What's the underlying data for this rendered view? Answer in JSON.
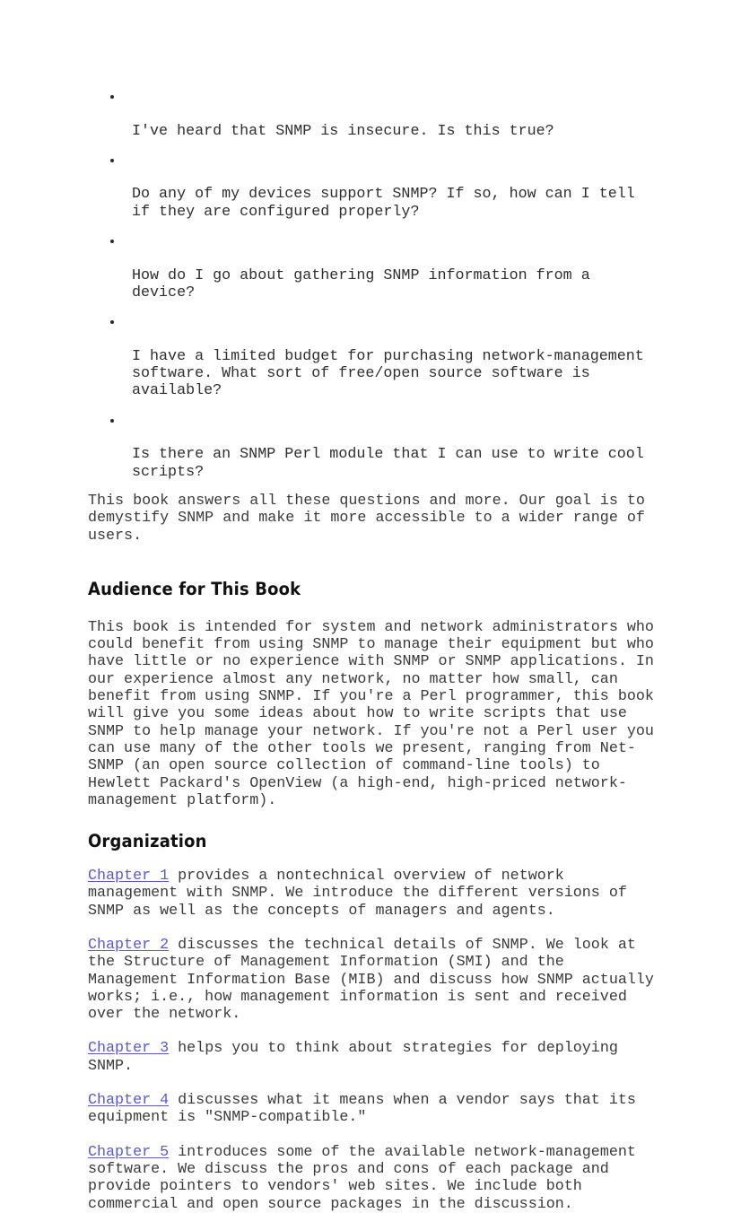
{
  "page": {
    "background_color": "#ffffff",
    "text_color": "#333333",
    "link_color": "#5a5ac8"
  },
  "questions": {
    "items": [
      "I've heard that SNMP is insecure. Is this true?",
      "Do any of my devices support SNMP? If so, how can I tell\nif they are configured properly?",
      "How do I go about gathering SNMP information from a\ndevice?",
      "I have a limited budget for purchasing network-management\nsoftware. What sort of free/open source software is\navailable?",
      "Is there an SNMP Perl module that I can use to write cool\nscripts?"
    ]
  },
  "intro": {
    "paragraph": "This book answers all these questions and more. Our goal is to\ndemystify SNMP and make it more accessible to a wider range of\nusers."
  },
  "audience": {
    "heading": "Audience for This Book",
    "paragraph": "This book is intended for system and network administrators who\ncould benefit from using SNMP to manage their equipment but who\nhave little or no experience with SNMP or SNMP applications. In\nour experience almost any network, no matter how small, can\nbenefit from using SNMP. If you're a Perl programmer, this book\nwill give you some ideas about how to write scripts that use\nSNMP to help manage your network. If you're not a Perl user you\ncan use many of the other tools we present, ranging from Net-\nSNMP (an open source collection of command-line tools) to\nHewlett Packard's OpenView (a high-end, high-priced network-\nmanagement platform)."
  },
  "organization": {
    "heading": "Organization",
    "chapters": [
      {
        "link": "Chapter 1",
        "text": " provides a nontechnical overview of network\nmanagement with SNMP. We introduce the different versions of\nSNMP as well as the concepts of managers and agents."
      },
      {
        "link": "Chapter 2",
        "text": " discusses the technical details of SNMP. We look at\nthe Structure of Management Information (SMI) and the\nManagement Information Base (MIB) and discuss how SNMP actually\nworks; i.e., how management information is sent and received\nover the network."
      },
      {
        "link": "Chapter 3",
        "text": " helps you to think about strategies for deploying\nSNMP."
      },
      {
        "link": "Chapter 4",
        "text": " discusses what it means when a vendor says that its\nequipment is \"SNMP-compatible.\""
      },
      {
        "link": "Chapter 5",
        "text": " introduces some of the available network-management\nsoftware. We discuss the pros and cons of each package and\nprovide pointers to vendors' web sites. We include both\ncommercial and open source packages in the discussion."
      }
    ]
  }
}
